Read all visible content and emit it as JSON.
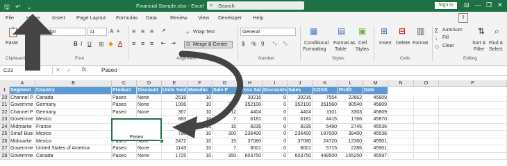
{
  "titlebar": {
    "quick_access": "🖫 ↶ ⌄",
    "filename": "Financial Sample.xlsx  -  Excel",
    "search_placeholder": "Search",
    "signin": "Sign in",
    "window_controls": [
      "⊟",
      "—",
      "❐",
      "✕"
    ]
  },
  "tabs": [
    "File",
    "Home",
    "Insert",
    "Page Layout",
    "Formulas",
    "Data",
    "Review",
    "View",
    "Developer",
    "Help"
  ],
  "share_label": "⇧",
  "ribbon": {
    "clipboard": {
      "paste": "Paste",
      "label": "Clipboard"
    },
    "font": {
      "name": "Calibri",
      "size": "11",
      "label": "Font",
      "bold": "B",
      "italic": "I",
      "underline": "U",
      "grow": "A",
      "shrink": "A"
    },
    "alignment": {
      "wrap": "Wrap Text",
      "merge": "Merge & Center",
      "label": "Alignment"
    },
    "number": {
      "format": "General",
      "currency": "$",
      "percent": "%",
      "comma": "9",
      "label": "Number"
    },
    "styles": {
      "conditional": [
        "Conditional",
        "Formatting"
      ],
      "format_table": [
        "Format as",
        "Table"
      ],
      "cell_styles": [
        "Cell",
        "Styles"
      ],
      "label": "Styles"
    },
    "cells": {
      "insert": "Insert",
      "delete": "Delete",
      "format": "Format",
      "label": "Cells"
    },
    "editing": {
      "autosum": "AutoSum",
      "fill": "Fill",
      "clear": "Clear",
      "sort": [
        "Sort &",
        "Filter"
      ],
      "find": [
        "Find &",
        "Select"
      ],
      "label": "Editing"
    }
  },
  "formula_bar": {
    "namebox": "C23",
    "fx": "fx",
    "value": "Paseo"
  },
  "columns": [
    "A",
    "B",
    "C",
    "D",
    "E",
    "F",
    "G",
    "H",
    "I",
    "J",
    "K",
    "L",
    "M",
    "N",
    "O",
    "P"
  ],
  "header_row": {
    "row_num": "1",
    "cells": [
      "Segment",
      "Country",
      "Product",
      "Discount",
      "Units Sold",
      "Manufac",
      "Sale P",
      "Gross Sal",
      "Discounts",
      "Sales",
      "COGS",
      "Profit",
      "Date"
    ]
  },
  "rows": [
    {
      "num": "20",
      "cells": [
        "Channel P",
        "Canada",
        "Paseo",
        "None",
        "2518",
        "10",
        "",
        "30216",
        "0",
        "30216",
        "7554",
        "22662",
        "45809"
      ]
    },
    {
      "num": "21",
      "cells": [
        "Governme",
        "Germany",
        "Paseo",
        "None",
        "1006",
        "10",
        "350",
        "352100",
        "0",
        "352100",
        "261560",
        "90540",
        "45809"
      ]
    },
    {
      "num": "22",
      "cells": [
        "Channel P",
        "Germany",
        "Paseo",
        "None",
        "367",
        "10",
        "12",
        "4404",
        "0",
        "4404",
        "1101",
        "3303",
        "45809"
      ]
    },
    {
      "num": "23",
      "cells": [
        "Governme",
        "Mexico",
        "",
        "",
        "883",
        "10",
        "7",
        "6181",
        "0",
        "6181",
        "4415",
        "1766",
        "45870"
      ]
    },
    {
      "num": "24",
      "cells": [
        "Midmarke",
        "France",
        "",
        "",
        "549",
        "10",
        "15",
        "8235",
        "0",
        "8235",
        "5490",
        "2745",
        "45536"
      ]
    },
    {
      "num": "25",
      "cells": [
        "Small Busi",
        "Mexico",
        "",
        "",
        "788",
        "10",
        "300",
        "236400",
        "0",
        "236400",
        "197000",
        "39400",
        "45536"
      ]
    },
    {
      "num": "26",
      "cells": [
        "Midmarke",
        "Mexico",
        "Paseo",
        "None",
        "2472",
        "10",
        "15",
        "37080",
        "0",
        "37080",
        "24720",
        "12360",
        "45901"
      ]
    },
    {
      "num": "27",
      "cells": [
        "Governme",
        "United States of America",
        "Paseo",
        "None",
        "1143",
        "10",
        "7",
        "8001",
        "0",
        "8001",
        "5715",
        "2286",
        "45901"
      ]
    },
    {
      "num": "28",
      "cells": [
        "Governme",
        "Canada",
        "Paseo",
        "None",
        "1725",
        "10",
        "350",
        "603750",
        "0",
        "603750",
        "448500",
        "155250",
        "45597"
      ]
    }
  ],
  "merged_cell_text": "Paseo",
  "colors": {
    "excel_green": "#1e7145",
    "header_blue": "#5b9bd5",
    "annotation_gray": "#444444"
  },
  "icons": [
    "save-icon",
    "undo-icon",
    "search-icon",
    "paste-icon",
    "wrap-text-icon",
    "merge-icon",
    "autosum-icon",
    "sort-icon",
    "find-icon",
    "annotation-arrow-up",
    "annotation-arrow-curved"
  ]
}
